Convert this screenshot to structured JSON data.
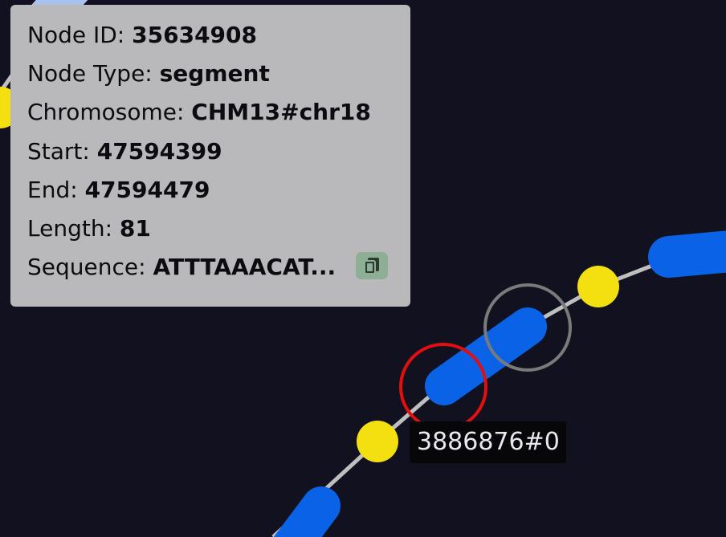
{
  "node_info": {
    "node_id_label": "Node ID:",
    "node_id": "35634908",
    "node_type_label": "Node Type:",
    "node_type": "segment",
    "chromosome_label": "Chromosome:",
    "chromosome": "CHM13#chr18",
    "start_label": "Start:",
    "start": "47594399",
    "end_label": "End:",
    "end": "47594479",
    "length_label": "Length:",
    "length": "81",
    "sequence_label": "Sequence:",
    "sequence": "ATTTAAACAT..."
  },
  "path_label": "3886876#0",
  "colors": {
    "background": "#12111f",
    "segment": "#0a63e6",
    "junction": "#f4df10",
    "edge": "#bfbfbf",
    "selected_ring": "#e01010",
    "hover_ring": "#7a7a7a",
    "panel": "#b9b9bb"
  }
}
